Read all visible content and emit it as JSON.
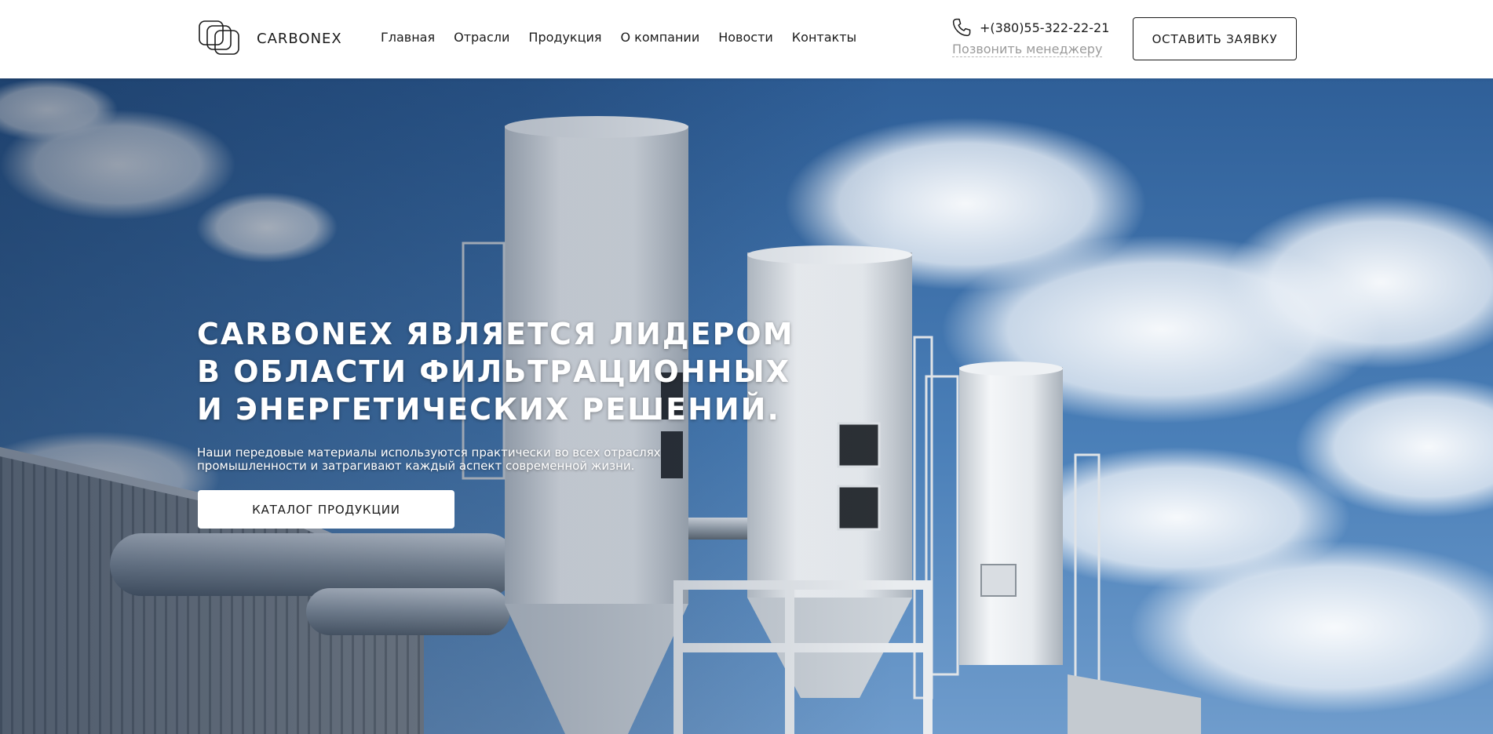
{
  "header": {
    "logo_text": "CARBONEX",
    "logo_icon": "overlapping-squares-logo",
    "nav": [
      {
        "label": "Главная"
      },
      {
        "label": "Отрасли"
      },
      {
        "label": "Продукция"
      },
      {
        "label": "О компании"
      },
      {
        "label": "Новости"
      },
      {
        "label": "Контакты"
      }
    ],
    "phone_icon": "phone-icon",
    "phone": "+(380)55-322-22-21",
    "callback_label": "Позвонить менеджеру",
    "order_button": "ОСТАВИТЬ ЗАЯВКУ"
  },
  "hero": {
    "title_lines": [
      "CARBONEX ЯВЛЯЕТСЯ ЛИДЕРОМ",
      "В ОБЛАСТИ ФИЛЬТРАЦИОННЫХ",
      "И ЭНЕРГЕТИЧЕСКИХ РЕШЕНИЙ."
    ],
    "subtitle_lines": [
      "Наши передовые материалы используются практически во всех отраслях",
      "промышленности и затрагивают каждый аспект современной жизни."
    ],
    "catalog_button": "КАТАЛОГ ПРОДУКЦИИ"
  },
  "colors": {
    "text": "#1b1b1b",
    "muted": "#9a9a9a",
    "sky": "#3f73ad",
    "white": "#ffffff"
  }
}
